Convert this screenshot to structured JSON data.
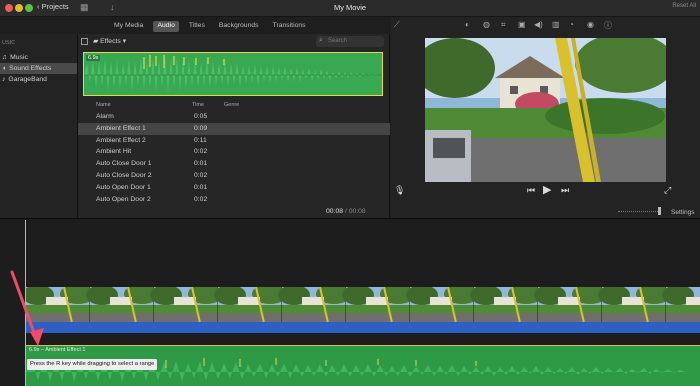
{
  "window": {
    "title": "My Movie",
    "back_label": "Projects",
    "right_hint": "Reset All"
  },
  "tabs": [
    {
      "label": "My Media",
      "active": false
    },
    {
      "label": "Audio",
      "active": true
    },
    {
      "label": "Titles",
      "active": false
    },
    {
      "label": "Backgrounds",
      "active": false
    },
    {
      "label": "Transitions",
      "active": false
    }
  ],
  "library": {
    "header": "USIC",
    "items": [
      {
        "label": "Music",
        "icon": "music-note-icon"
      },
      {
        "label": "Sound Effects",
        "icon": "speaker-icon",
        "selected": true
      },
      {
        "label": "GarageBand",
        "icon": "guitar-icon"
      }
    ]
  },
  "browser": {
    "folder_label": "Effects",
    "search_placeholder": "Search",
    "preview_duration": "6.9s",
    "columns": {
      "name": "Name",
      "time": "Time",
      "genre": "Genre"
    },
    "rows": [
      {
        "name": "Alarm",
        "time": "0:05"
      },
      {
        "name": "Ambient Effect 1",
        "time": "0:09",
        "selected": true
      },
      {
        "name": "Ambient Effect 2",
        "time": "0:11"
      },
      {
        "name": "Ambient Hit",
        "time": "0:02"
      },
      {
        "name": "Auto Close Door 1",
        "time": "0:01"
      },
      {
        "name": "Auto Close Door 2",
        "time": "0:02"
      },
      {
        "name": "Auto Open Door 1",
        "time": "0:01"
      },
      {
        "name": "Auto Open Door 2",
        "time": "0:02"
      }
    ],
    "timecode_current": "00:08",
    "timecode_total": "00:08"
  },
  "viewer": {
    "settings_label": "Settings"
  },
  "timeline": {
    "clip_label": "6.9s – Ambient Effect 1",
    "tooltip": "Press the R key while dragging to select a range"
  },
  "colors": {
    "waveform": "#3aa853",
    "selection_border": "#e3d94a",
    "audio_band": "#2f5fc2",
    "annotation_arrow": "#f04b6e"
  }
}
